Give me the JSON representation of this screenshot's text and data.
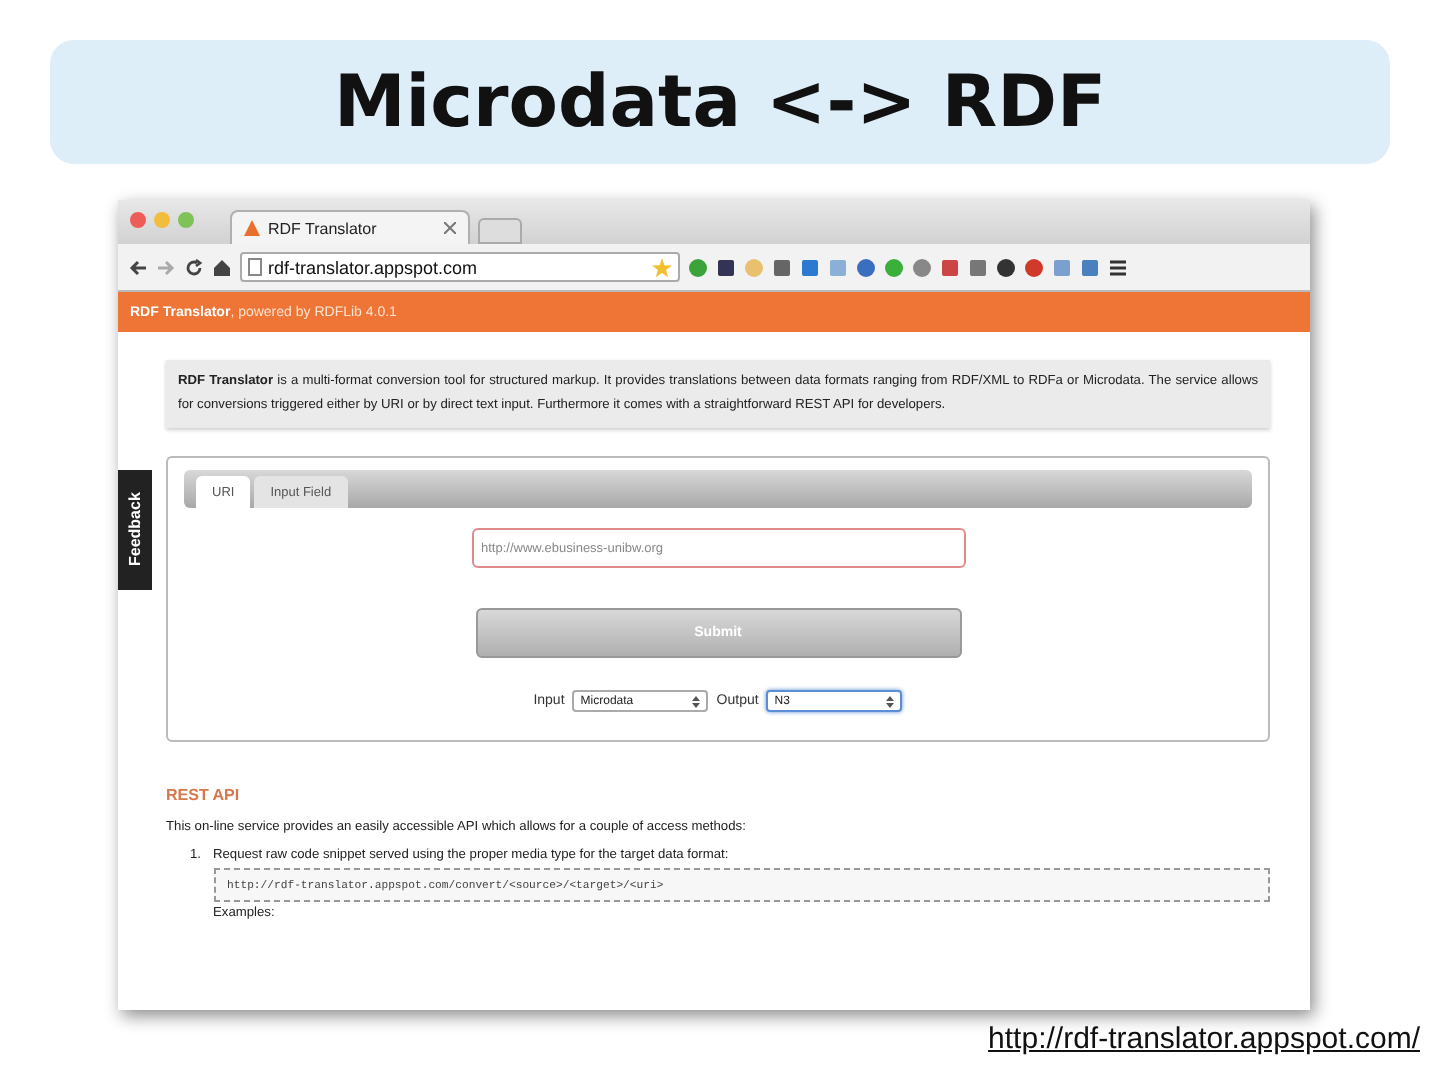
{
  "slide": {
    "title": "Microdata <-> RDF",
    "link": "http://rdf-translator.appspot.com/"
  },
  "browser": {
    "tab_title": "RDF Translator",
    "address": "rdf-translator.appspot.com"
  },
  "page": {
    "header": "**RDF Translator**, powered by RDFLib 4.0.1",
    "intro": "**RDF Translator** is a multi-format conversion tool for structured markup. It provides translations between data formats ranging from RDF/XML to RDFa or Microdata. The service allows for conversions triggered either by URI or by direct text input. Furthermore it comes with a straightforward REST API for developers.",
    "feedback": "Feedback",
    "tabs": [
      {
        "label": "URI",
        "selected": true
      },
      {
        "label": "Input Field",
        "selected": false
      }
    ],
    "uri_placeholder": "http://www.ebusiness-unibw.org",
    "submit": "Submit",
    "selects": [
      {
        "label": "Input",
        "value": "Microdata",
        "focused": false
      },
      {
        "label": "Output",
        "value": "N3",
        "focused": true
      }
    ],
    "rest_heading": "REST API",
    "rest_text": "This on-line service provides an easily accessible API which allows for a couple of access methods:",
    "steps": [
      {
        "number": "1.",
        "text": "Request raw code snippet served using the proper media type for the target data format:",
        "code": "http://rdf-translator.appspot.com/convert/<source>/<target>/<uri>",
        "after": "Examples:"
      }
    ]
  }
}
